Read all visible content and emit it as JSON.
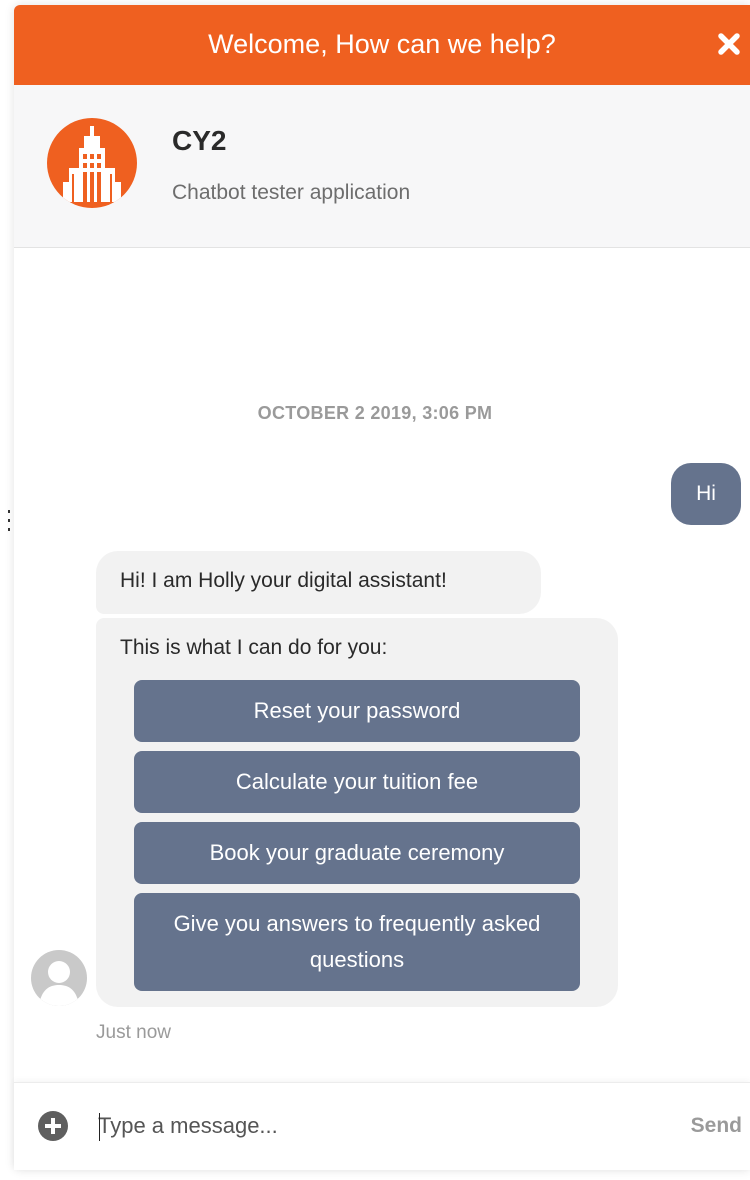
{
  "header": {
    "title": "Welcome, How can we help?",
    "close_icon": "close-icon",
    "accent_color": "#EF6020"
  },
  "profile": {
    "name": "CY2",
    "subtitle": "Chatbot tester application",
    "logo_icon": "building-icon"
  },
  "conversation": {
    "date_separator": "OCTOBER 2 2019, 3:06 PM",
    "user_message": "Hi",
    "bot_greeting": "Hi! I am Holly your digital assistant!",
    "bot_intro": "This is what I can do for you:",
    "options": [
      "Reset your password",
      "Calculate your tuition fee",
      "Book your graduate ceremony",
      "Give you answers to frequently asked questions"
    ],
    "bot_time": "Just now",
    "bubble_color": "#65738D"
  },
  "composer": {
    "placeholder": "Type a message...",
    "send_label": "Send",
    "attach_icon": "plus-circle-icon"
  }
}
